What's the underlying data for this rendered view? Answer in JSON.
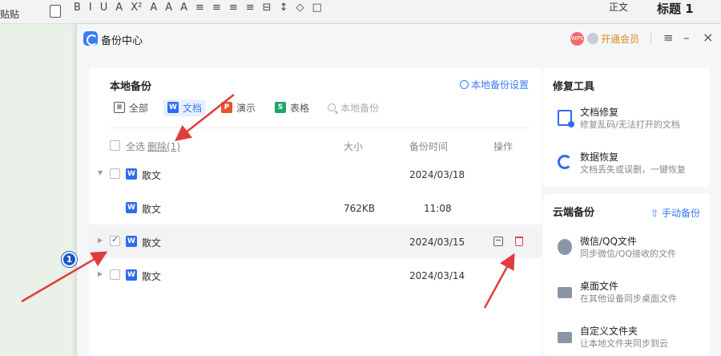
{
  "background": {
    "paste_label": "贴贴",
    "format_glyphs": [
      "B",
      "I",
      "U",
      "A",
      "X²",
      "A",
      "A",
      "A",
      "≡",
      "≡",
      "≡",
      "≡",
      "⊟",
      "↕",
      "◇",
      "□"
    ],
    "style_normal": "正文",
    "style_heading": "标题 1"
  },
  "window": {
    "title": "备份中心",
    "avatar_text": "WPS",
    "vip_label": "开通会员",
    "menu_glyph": "≡",
    "minimize_glyph": "–",
    "close_glyph": "×"
  },
  "local_backup": {
    "title": "本地备份",
    "settings_label": "本地备份设置",
    "tabs": [
      {
        "label": "全部",
        "icon": "grid-icon",
        "badge": "▦"
      },
      {
        "label": "文档",
        "icon": "word-icon",
        "badge": "W"
      },
      {
        "label": "演示",
        "icon": "ppt-icon",
        "badge": "P"
      },
      {
        "label": "表格",
        "icon": "sheet-icon",
        "badge": "S"
      }
    ],
    "search_placeholder": "本地备份",
    "select_all_label": "全选",
    "delete_label": "删除(1)",
    "columns": {
      "size": "大小",
      "time": "备份时间",
      "actions": "操作"
    },
    "rows": [
      {
        "name": "散文",
        "badge": "W",
        "size": "",
        "time": "2024/03/18",
        "expanded": true,
        "checked": false
      },
      {
        "name": "散文",
        "badge": "W",
        "size": "762KB",
        "time": "11:08",
        "child": true
      },
      {
        "name": "散文",
        "badge": "W",
        "size": "",
        "time": "2024/03/15",
        "expanded": false,
        "checked": true
      },
      {
        "name": "散文",
        "badge": "W",
        "size": "",
        "time": "2024/03/14",
        "expanded": false,
        "checked": false
      }
    ]
  },
  "repair_tools": {
    "title": "修复工具",
    "items": [
      {
        "name": "文档修复",
        "desc": "修复乱码/无法打开的文档",
        "icon": "doc-repair-icon"
      },
      {
        "name": "数据恢复",
        "desc": "文档丢失或误删，一键恢复",
        "icon": "data-recovery-icon"
      }
    ]
  },
  "cloud_backup": {
    "title": "云端备份",
    "manual_label": "手动备份",
    "items": [
      {
        "name": "微信/QQ文件",
        "desc": "同步微信/QQ接收的文件",
        "icon": "wechat-qq-icon"
      },
      {
        "name": "桌面文件",
        "desc": "在其他设备同步桌面文件",
        "icon": "desktop-icon"
      },
      {
        "name": "自定义文件夹",
        "desc": "让本地文件夹同步到云",
        "icon": "folder-icon"
      }
    ]
  },
  "annotation": {
    "badge": "1",
    "color": "#e03c3c"
  }
}
